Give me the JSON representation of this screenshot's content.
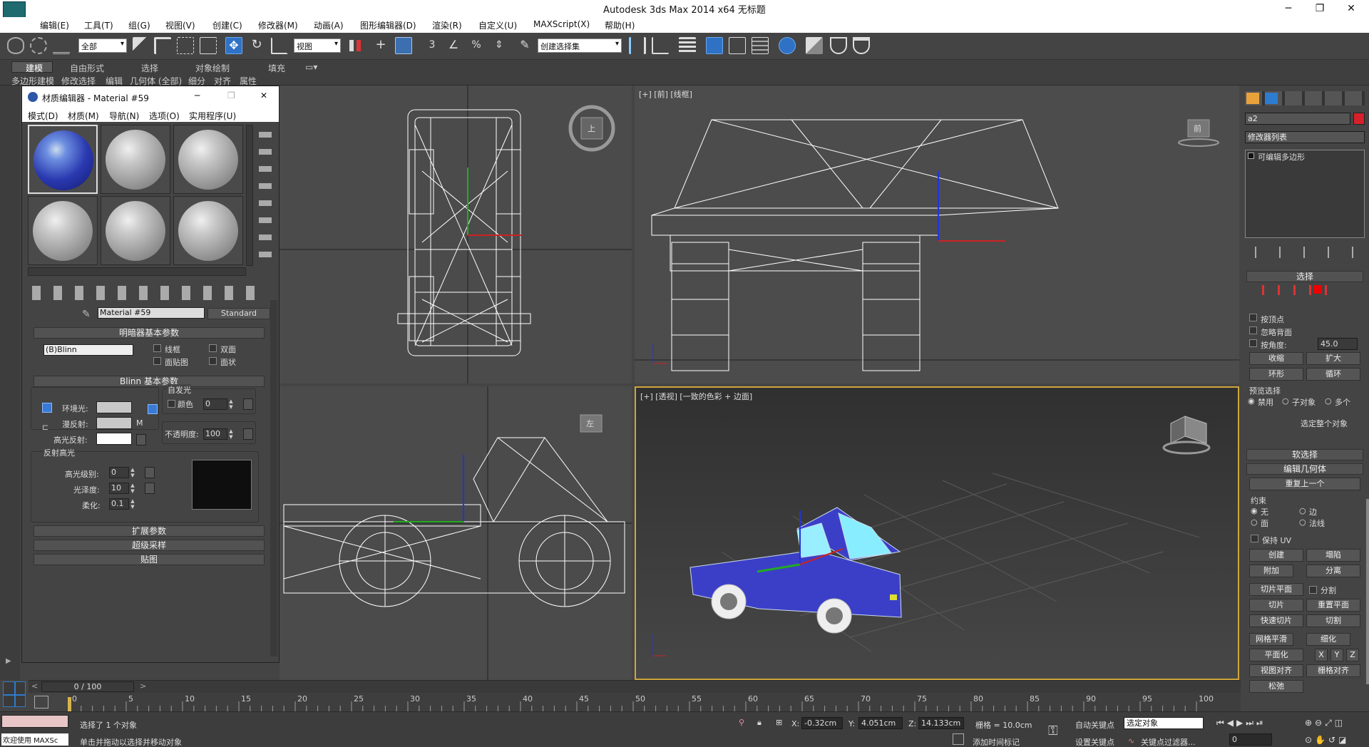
{
  "window": {
    "title": "Autodesk 3ds Max  2014 x64        无标题",
    "min": "─",
    "max": "❐",
    "close": "✕"
  },
  "menu": [
    "编辑(E)",
    "工具(T)",
    "组(G)",
    "视图(V)",
    "创建(C)",
    "修改器(M)",
    "动画(A)",
    "图形编辑器(D)",
    "渲染(R)",
    "自定义(U)",
    "MAXScript(X)",
    "帮助(H)"
  ],
  "toolbar": {
    "filter": "全部",
    "coord": "视图",
    "named_set": "创建选择集",
    "snap3": "3",
    "snap_pct": "%"
  },
  "ribbon": {
    "tabs": [
      "建模",
      "自由形式",
      "选择",
      "对象绘制",
      "填充"
    ],
    "subs": [
      "多边形建模",
      "修改选择",
      "编辑",
      "几何体 (全部)",
      "细分",
      "对齐",
      "属性"
    ]
  },
  "viewports": {
    "top_label": "",
    "front_label": "[+] [前] [线框]",
    "left_label": "",
    "persp_label": "[+] [透视] [一致的色彩 + 边面]",
    "cube_top": "上",
    "cube_front": "前",
    "cube_left": "左"
  },
  "material_editor": {
    "title": "材质编辑器 - Material #59",
    "menu": [
      "模式(D)",
      "材质(M)",
      "导航(N)",
      "选项(O)",
      "实用程序(U)"
    ],
    "material_name": "Material #59",
    "material_type": "Standard",
    "shader_roll": "明暗器基本参数",
    "shader": "(B)Blinn",
    "opts": [
      "线框",
      "双面",
      "面贴图",
      "面状"
    ],
    "blinn_roll": "Blinn 基本参数",
    "self_illum": "自发光",
    "color_label": "颜色",
    "color_val": "0",
    "ambient": "环境光:",
    "diffuse": "漫反射:",
    "specular": "高光反射:",
    "m": "M",
    "opacity_label": "不透明度:",
    "opacity_val": "100",
    "spec_group": "反射高光",
    "spec_level": "高光级别:",
    "spec_level_val": "0",
    "gloss": "光泽度:",
    "gloss_val": "10",
    "soften": "柔化:",
    "soften_val": "0.1",
    "rollouts": [
      "扩展参数",
      "超级采样",
      "贴图"
    ]
  },
  "command_panel": {
    "object_name": "a2",
    "modifier_list": "修改器列表",
    "stack_item": "可编辑多边形",
    "select_roll": "选择",
    "by_vertex": "按顶点",
    "ignore_back": "忽略背面",
    "by_angle": "按角度:",
    "angle_val": "45.0",
    "shrink": "收缩",
    "grow": "扩大",
    "ring": "环形",
    "loop": "循环",
    "preview": "预览选择",
    "disable": "禁用",
    "subobj": "子对象",
    "multi": "多个",
    "selected_whole": "选定整个对象",
    "soft_roll": "软选择",
    "edit_geo_roll": "编辑几何体",
    "repeat_last": "重复上一个",
    "constraint": "约束",
    "none": "无",
    "edge": "边",
    "face": "面",
    "normal": "法线",
    "keep_uv": "保持 UV",
    "create": "创建",
    "collapse": "塌陷",
    "attach": "附加",
    "detach": "分离",
    "slice_plane": "切片平面",
    "split": "分割",
    "slice": "切片",
    "reset_plane": "重置平面",
    "quick_slice": "快速切片",
    "cut": "切割",
    "meshsmooth": "网格平滑",
    "tessellate": "细化",
    "planarize": "平面化",
    "x": "X",
    "y": "Y",
    "z": "Z",
    "view_align": "视图对齐",
    "grid_align": "栅格对齐",
    "relax": "松弛"
  },
  "timeline": {
    "frame": "0 / 100",
    "ticks": [
      "0",
      "5",
      "10",
      "15",
      "20",
      "25",
      "30",
      "35",
      "40",
      "45",
      "50",
      "55",
      "60",
      "65",
      "70",
      "75",
      "80",
      "85",
      "90",
      "95",
      "100"
    ]
  },
  "status": {
    "selected": "选择了 1 个对象",
    "hint": "单击并拖动以选择并移动对象",
    "welcome": "欢迎使用 MAXSc",
    "x_label": "X:",
    "x_val": "-0.32cm",
    "y_label": "Y:",
    "y_val": "4.051cm",
    "z_label": "Z:",
    "z_val": "14.133cm",
    "grid": "栅格 = 10.0cm",
    "add_time_tag": "添加时间标记",
    "auto_key": "自动关键点",
    "set_key": "设置关键点",
    "key_sel": "选定对象",
    "key_filters": "关键点过滤器...",
    "frame_val": "0"
  }
}
